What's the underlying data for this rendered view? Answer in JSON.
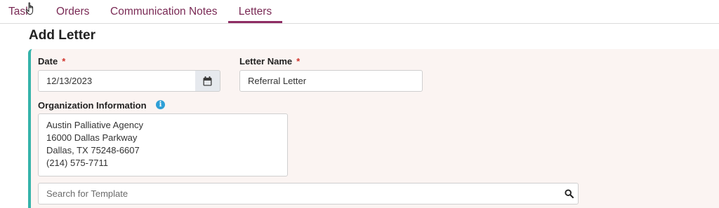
{
  "tabs": [
    {
      "label": "Task",
      "active": false
    },
    {
      "label": "Orders",
      "active": false
    },
    {
      "label": "Communication Notes",
      "active": false
    },
    {
      "label": "Letters",
      "active": true
    }
  ],
  "page": {
    "title": "Add Letter"
  },
  "form": {
    "date": {
      "label": "Date",
      "required_mark": "*",
      "value": "12/13/2023",
      "icon": "calendar-icon"
    },
    "letter_name": {
      "label": "Letter Name",
      "required_mark": "*",
      "value": "Referral Letter"
    },
    "organization": {
      "label": "Organization Information",
      "info_icon": "i",
      "lines": [
        "Austin Palliative Agency",
        "16000 Dallas Parkway",
        "Dallas, TX 75248-6607",
        "(214) 575-7711"
      ]
    },
    "template_search": {
      "placeholder": "Search for Template",
      "icon": "search-icon"
    }
  },
  "colors": {
    "tab_text": "#7a2a55",
    "tab_active_underline": "#8e2c63",
    "card_accent": "#36b3aa",
    "card_background": "#fbf4f2",
    "required": "#d0342c",
    "info": "#2f9fd6"
  }
}
